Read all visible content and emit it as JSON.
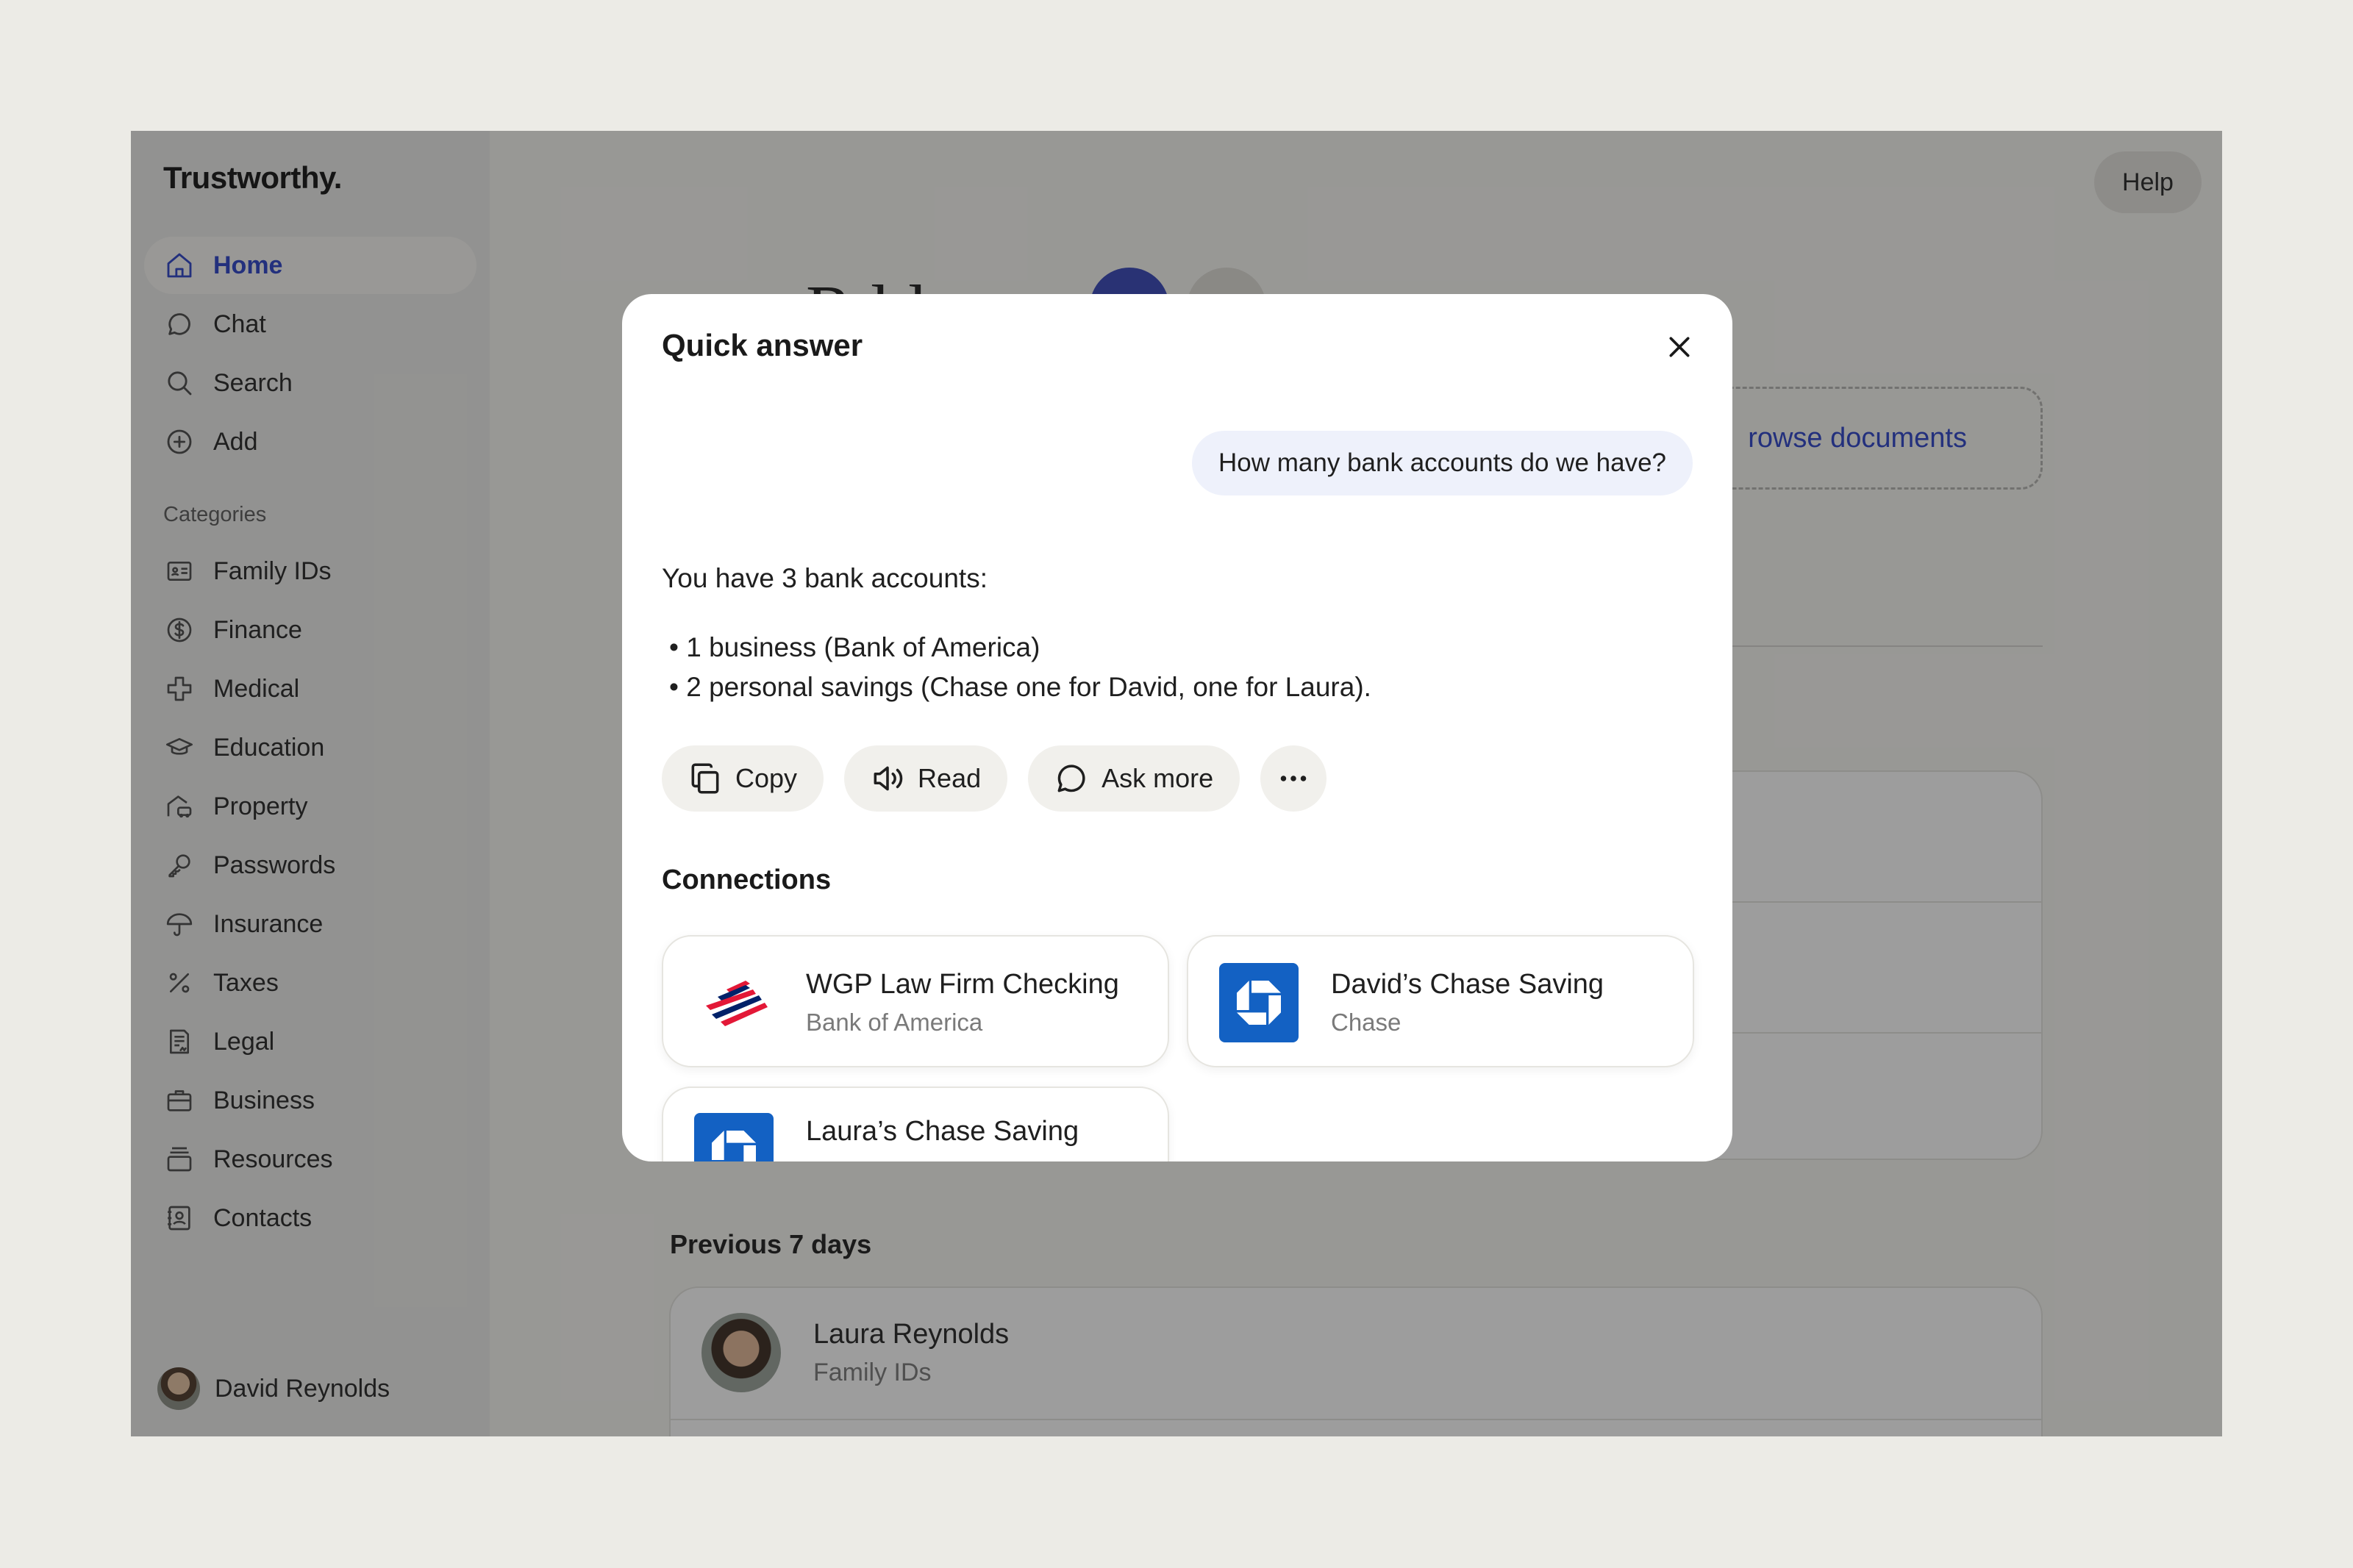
{
  "sidebar": {
    "brand": "Trustworthy.",
    "nav": [
      {
        "label": "Home",
        "icon": "home-icon",
        "active": true
      },
      {
        "label": "Chat",
        "icon": "chat-icon"
      },
      {
        "label": "Search",
        "icon": "search-icon"
      },
      {
        "label": "Add",
        "icon": "plus-circle-icon"
      }
    ],
    "categories_title": "Categories",
    "categories": [
      {
        "label": "Family IDs",
        "icon": "id-card-icon"
      },
      {
        "label": "Finance",
        "icon": "dollar-circle-icon"
      },
      {
        "label": "Medical",
        "icon": "medical-cross-icon"
      },
      {
        "label": "Education",
        "icon": "graduation-cap-icon"
      },
      {
        "label": "Property",
        "icon": "house-car-icon"
      },
      {
        "label": "Passwords",
        "icon": "key-icon"
      },
      {
        "label": "Insurance",
        "icon": "umbrella-icon"
      },
      {
        "label": "Taxes",
        "icon": "percent-icon"
      },
      {
        "label": "Legal",
        "icon": "legal-document-icon"
      },
      {
        "label": "Business",
        "icon": "briefcase-icon"
      },
      {
        "label": "Resources",
        "icon": "stack-icon"
      },
      {
        "label": "Contacts",
        "icon": "contact-book-icon"
      }
    ],
    "user_name": "David Reynolds"
  },
  "header": {
    "help_label": "Help"
  },
  "main": {
    "title_partial": "R    ld",
    "browse_label": "rowse documents",
    "previous_title": "Previous 7 days",
    "recent": {
      "name": "Laura Reynolds",
      "sub": "Family IDs"
    }
  },
  "modal": {
    "title": "Quick answer",
    "question": "How many bank accounts do we have?",
    "answer": "You have 3 bank accounts:",
    "bullets": [
      "1 business (Bank of America)",
      "2 personal savings (Chase one for David, one for Laura)."
    ],
    "actions": {
      "copy": "Copy",
      "read": "Read",
      "ask_more": "Ask more"
    },
    "connections_title": "Connections",
    "connections": [
      {
        "name": "WGP Law Firm Checking",
        "sub": "Bank of America",
        "logo": "bank-of-america-logo"
      },
      {
        "name": "David’s Chase Saving",
        "sub": "Chase",
        "logo": "chase-logo"
      },
      {
        "name": "Laura’s Chase Saving",
        "sub": "",
        "logo": "chase-logo"
      }
    ]
  },
  "colors": {
    "accent": "#2d44c8",
    "chase_blue": "#1361c3",
    "boa_red": "#e31837",
    "boa_navy": "#012169"
  }
}
